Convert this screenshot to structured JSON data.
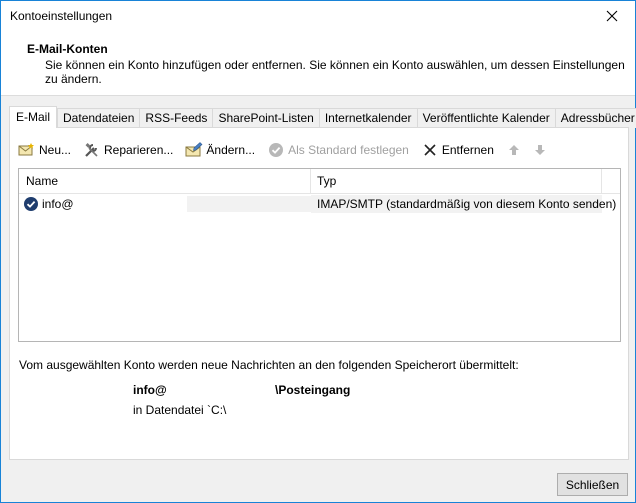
{
  "window": {
    "title": "Kontoeinstellungen"
  },
  "header": {
    "title": "E-Mail-Konten",
    "description": "Sie können ein Konto hinzufügen oder entfernen. Sie können ein Konto auswählen, um dessen Einstellungen zu ändern."
  },
  "tabs": [
    {
      "label": "E-Mail"
    },
    {
      "label": "Datendateien"
    },
    {
      "label": "RSS-Feeds"
    },
    {
      "label": "SharePoint-Listen"
    },
    {
      "label": "Internetkalender"
    },
    {
      "label": "Veröffentlichte Kalender"
    },
    {
      "label": "Adressbücher"
    }
  ],
  "toolbar": {
    "new_label": "Neu...",
    "repair_label": "Reparieren...",
    "change_label": "Ändern...",
    "default_label": "Als Standard festlegen",
    "remove_label": "Entfernen"
  },
  "list": {
    "columns": {
      "name": "Name",
      "type": "Typ"
    },
    "rows": [
      {
        "name": "info@",
        "type": "IMAP/SMTP (standardmäßig von diesem Konto senden)"
      }
    ]
  },
  "delivery": {
    "info": "Vom ausgewählten Konto werden neue Nachrichten an den folgenden Speicherort übermittelt:",
    "account": "info@",
    "folder": "\\Posteingang",
    "file": "in Datendatei `C:\\"
  },
  "footer": {
    "close_label": "Schließen"
  },
  "colors": {
    "accent": "#1883d7",
    "default_check": "#1f3d6e"
  }
}
